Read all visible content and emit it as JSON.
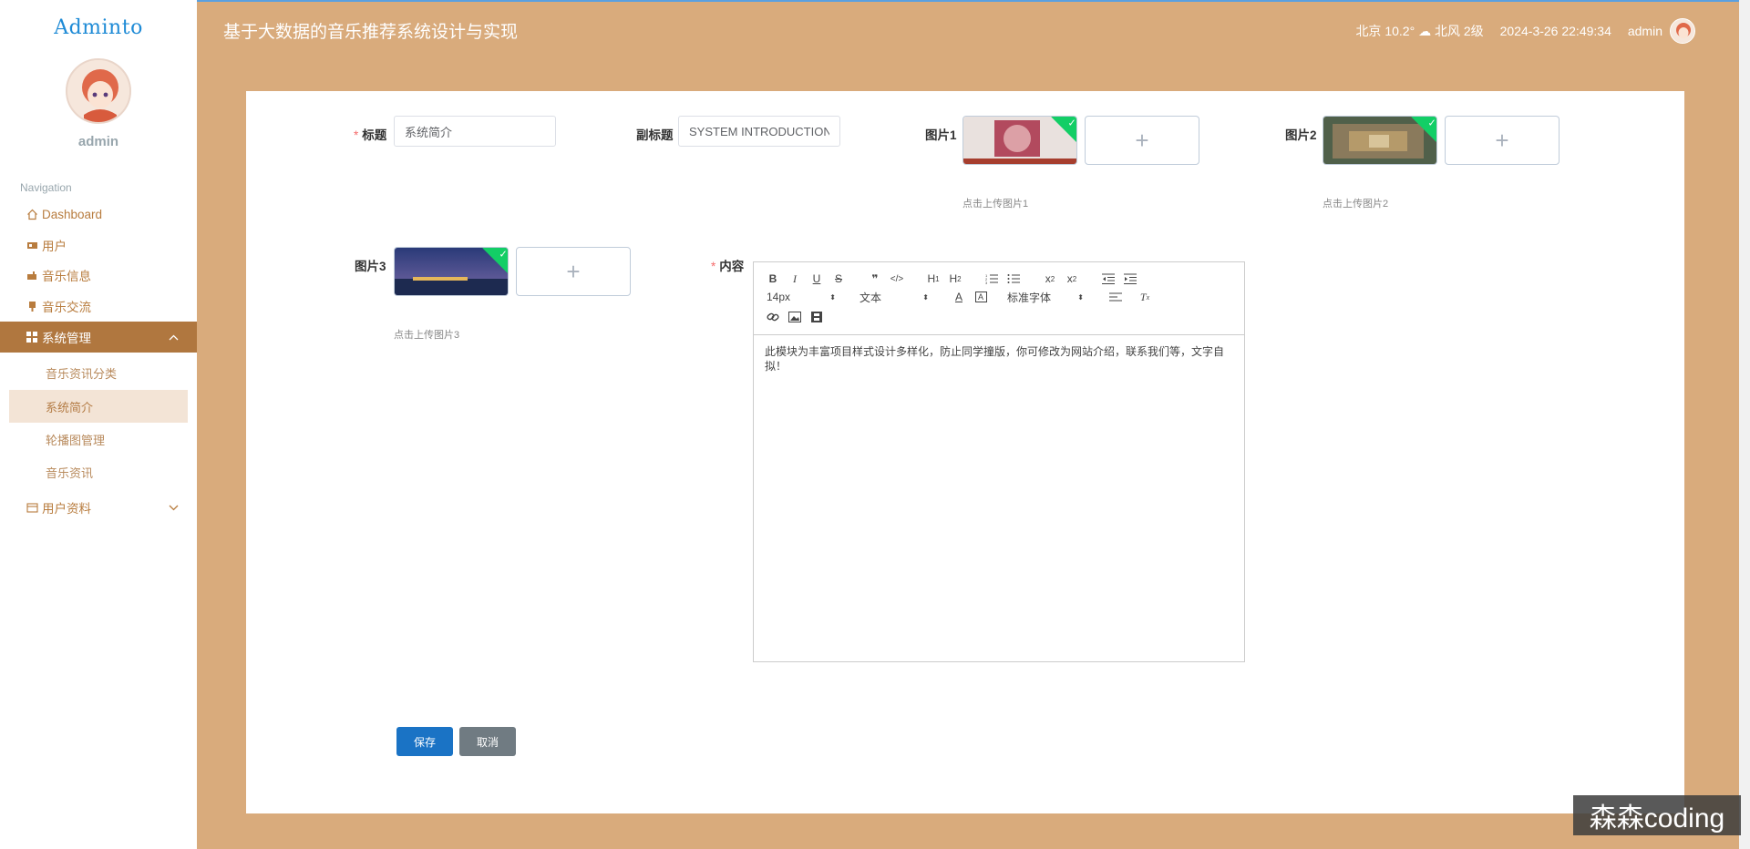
{
  "app": {
    "logo": "Adminto",
    "title": "基于大数据的音乐推荐系统设计与实现",
    "username": "admin"
  },
  "header": {
    "weather": "北京  10.2°  ☁  北风  2级",
    "datetime": "2024-3-26 22:49:34",
    "user": "admin"
  },
  "sidebar": {
    "caption": "Navigation",
    "items": [
      {
        "label": "Dashboard",
        "icon": "home-icon"
      },
      {
        "label": "用户",
        "icon": "user-icon"
      },
      {
        "label": "音乐信息",
        "icon": "music-icon"
      },
      {
        "label": "音乐交流",
        "icon": "chat-icon"
      },
      {
        "label": "系统管理",
        "icon": "grid-icon"
      },
      {
        "label": "用户资料",
        "icon": "profile-icon"
      }
    ],
    "submenu": [
      {
        "label": "音乐资讯分类"
      },
      {
        "label": "系统简介"
      },
      {
        "label": "轮播图管理"
      },
      {
        "label": "音乐资讯"
      }
    ]
  },
  "form": {
    "title_label": "标题",
    "title_value": "系统简介",
    "subtitle_label": "副标题",
    "subtitle_value": "SYSTEM INTRODUCTION",
    "pic1_label": "图片1",
    "pic1_hint": "点击上传图片1",
    "pic2_label": "图片2",
    "pic2_hint": "点击上传图片2",
    "pic3_label": "图片3",
    "pic3_hint": "点击上传图片3",
    "content_label": "内容",
    "plus": "+",
    "save": "保存",
    "cancel": "取消"
  },
  "editor": {
    "size": "14px",
    "block": "文本",
    "font": "标准字体",
    "content": "此模块为丰富项目样式设计多样化，防止同学撞版，你可修改为网站介绍，联系我们等，文字自拟！"
  },
  "watermark": "森森coding"
}
